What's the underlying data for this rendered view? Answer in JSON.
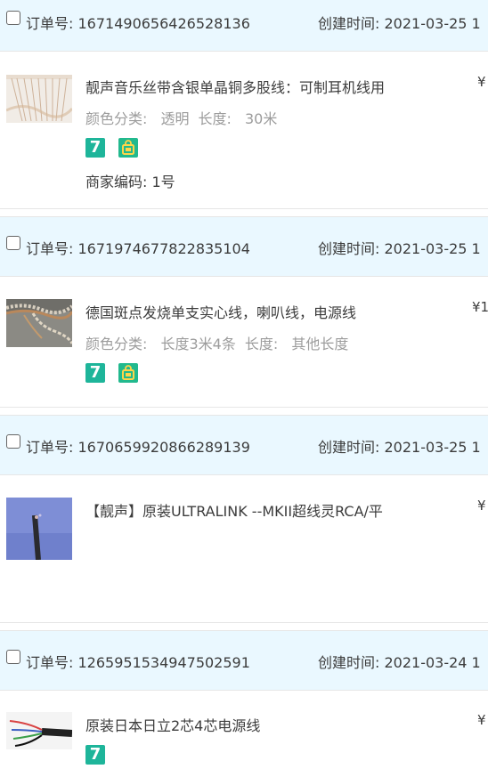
{
  "labels": {
    "order_no_label": "订单号: ",
    "created_label": "创建时间: ",
    "sku_color_label": "颜色分类: ",
    "sku_length_label": "长度: ",
    "merchant_code_label": "商家编码: ",
    "currency": "¥"
  },
  "badges": {
    "seven_day": "7"
  },
  "orders": [
    {
      "order_no": "1671490656426528136",
      "created": "2021-03-25 1",
      "title": "靓声音乐丝带含银单晶铜多股线：可制耳机线用",
      "color_value": "透明",
      "length_value": "30米",
      "merchant_code_value": "1号",
      "price_text": "¥",
      "badges": [
        "seven-day-return-icon",
        "shopping-bag-icon"
      ]
    },
    {
      "order_no": "1671974677822835104",
      "created": "2021-03-25 1",
      "title": "德国斑点发烧单支实心线，喇叭线，电源线",
      "color_value": "长度3米4条",
      "length_value": "其他长度",
      "price_text": "¥1",
      "badges": [
        "seven-day-return-icon",
        "shopping-bag-icon"
      ]
    },
    {
      "order_no": "1670659920866289139",
      "created": "2021-03-25 1",
      "title": "【靓声】原装ULTRALINK --MKII超线灵RCA/平",
      "price_text": "¥"
    },
    {
      "order_no": "1265951534947502591",
      "created": "2021-03-24 1",
      "title": "原装日本日立2芯4芯电源线",
      "price_text": "¥",
      "badges": [
        "seven-day-return-icon"
      ]
    }
  ],
  "colors": {
    "header_bg": "#eaf8ff",
    "badge_green": "#1eb59a",
    "muted_text": "#9c9c9c"
  }
}
